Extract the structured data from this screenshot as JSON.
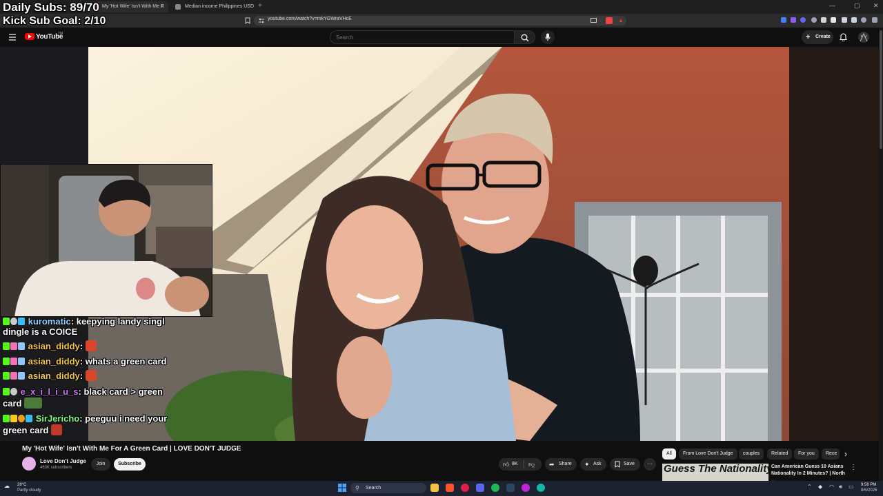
{
  "browser": {
    "tabs": [
      {
        "label": "My 'Hot Wife' Isn't With Me F",
        "active": true
      },
      {
        "label": "Median income Philippines USD",
        "active": false
      }
    ],
    "new_tab": "+",
    "window_controls": {
      "min": "—",
      "max": "▢",
      "close": "✕"
    },
    "url": "youtube.com/watch?v=mkYGWraVHcE"
  },
  "overlay": {
    "daily_subs": "Daily Subs: 89/70",
    "kick_goal": "Kick Sub Goal: 2/10"
  },
  "youtube": {
    "logo": "YouTube",
    "logo_tm": "TM",
    "search_placeholder": "Search",
    "create_label": "Create",
    "video_title": "My 'Hot Wife' Isn't With Me For A Green Card | LOVE DON'T JUDGE",
    "channel_name": "Love Don't Judge",
    "channel_subs": "463K subscribers",
    "join_label": "Join",
    "subscribe_label": "Subscribe",
    "like_count": "8K",
    "share_label": "Share",
    "ask_label": "Ask",
    "save_label": "Save",
    "more_label": "···",
    "chips": [
      "All",
      "From Love Don't Judge",
      "couples",
      "Related",
      "For you",
      "Rece"
    ],
    "chip_next": "›",
    "recommended": {
      "thumb_text": "Guess The Nationality",
      "title": "Can American Guess 10 Asians Nationality In 2 Minutes? | North ...",
      "more": "⋮"
    }
  },
  "chat": [
    {
      "user": "kuromatic",
      "user_color": "#8fd0ff",
      "text": "keepying landy singl",
      "cont": "dingle is a COICE"
    },
    {
      "user": "asian_diddy",
      "user_color": "#f5c542",
      "text": ""
    },
    {
      "user": "asian_diddy",
      "user_color": "#f5c542",
      "text": "whats a green card"
    },
    {
      "user": "asian_diddy",
      "user_color": "#f5c542",
      "text": ""
    },
    {
      "user": "e_x_i_l_i_u_s",
      "user_color": "#d070ff",
      "text": "black card > green",
      "cont": "card"
    },
    {
      "user": "SirJericho",
      "user_color": "#7CFC7C",
      "text": "peeguu i need your",
      "cont": "green card"
    }
  ],
  "taskbar": {
    "weather_temp": "28°C",
    "weather_desc": "Partly cloudy",
    "search_label": "Search",
    "time": "9:56 PM",
    "date": "8/5/2026"
  },
  "colors": {
    "yt_red": "#ff0000",
    "bg": "#0f0f0f",
    "kick_green": "#53fc18"
  }
}
